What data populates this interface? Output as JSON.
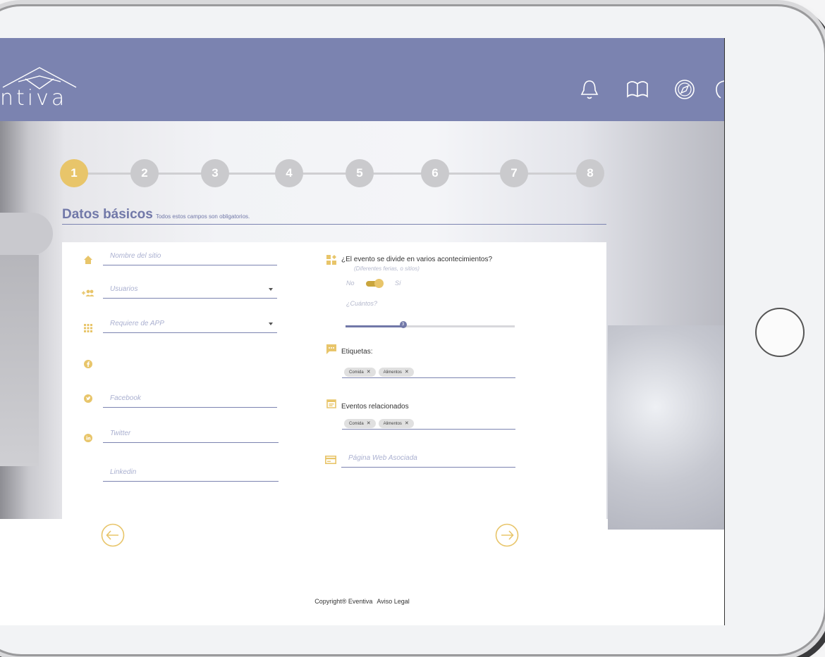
{
  "app": {
    "logo_text": "ntiva"
  },
  "header_icons": [
    {
      "name": "bell-icon"
    },
    {
      "name": "book-icon"
    },
    {
      "name": "compass-icon"
    },
    {
      "name": "settings-icon"
    }
  ],
  "steps": [
    "1",
    "2",
    "3",
    "4",
    "5",
    "6",
    "7",
    "8"
  ],
  "active_step": 1,
  "section": {
    "title": "Datos básicos",
    "subtitle": "Todos estos campos son obligatorios."
  },
  "left_fields": {
    "site": {
      "placeholder": "Nombre del sitio",
      "icon": "home-icon"
    },
    "users": {
      "placeholder": "Usuarios",
      "icon": "add-users-icon"
    },
    "app": {
      "placeholder": "Requiere de APP",
      "icon": "apps-grid-icon"
    },
    "facebook": {
      "placeholder": "Facebook",
      "icon": "facebook-icon"
    },
    "twitter": {
      "placeholder": "Twitter",
      "icon": "twitter-icon"
    },
    "linkedin": {
      "placeholder": "Linkedin",
      "icon": "linkedin-icon"
    }
  },
  "right": {
    "split_question": "¿El evento se divide en varios acontecimientos?",
    "split_hint": "(Diferentes ferias, o sitios)",
    "toggle_no": "No",
    "toggle_yes": "Sí",
    "toggle_on": true,
    "count_label": "¿Cuántos?",
    "count_value": "3",
    "count_fraction": 0.34,
    "tags_label": "Etiquetas:",
    "tags": [
      "Comida",
      "Alimentos"
    ],
    "related_label": "Eventos relacionados",
    "related": [
      "Comida",
      "Alimentos"
    ],
    "web_placeholder": "Página Web Asociada"
  },
  "footer": {
    "copyright": "Copyright® Eventiva",
    "legal": "Aviso Legal"
  },
  "colors": {
    "header": "#7b83b0",
    "accent": "#e8c56a",
    "primary": "#7178a8"
  }
}
